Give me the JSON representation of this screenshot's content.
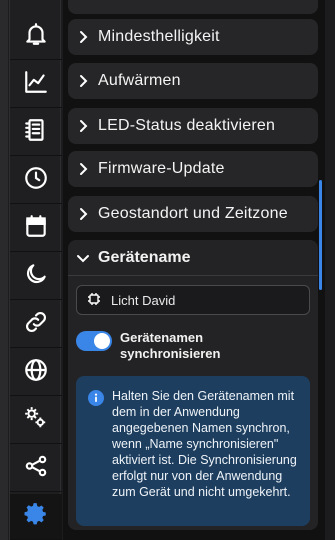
{
  "colors": {
    "accent": "#3a86e8",
    "info_bg": "#1d3e5f",
    "row_bg": "#262628"
  },
  "sidebar": {
    "items": [
      {
        "icon": "bell-icon"
      },
      {
        "icon": "line-chart-icon"
      },
      {
        "icon": "led-panel-icon"
      },
      {
        "icon": "clock-icon"
      },
      {
        "icon": "calendar-icon"
      },
      {
        "icon": "moon-icon"
      },
      {
        "icon": "link-icon"
      },
      {
        "icon": "globe-icon"
      },
      {
        "icon": "gears-icon"
      },
      {
        "icon": "share-icon"
      },
      {
        "icon": "settings-gear-icon",
        "active": true
      }
    ]
  },
  "sections": [
    {
      "label": "Mindesthelligkeit"
    },
    {
      "label": "Aufwärmen"
    },
    {
      "label": "LED-Status deaktivieren"
    },
    {
      "label": "Firmware-Update"
    },
    {
      "label": "Geostandort und Zeitzone"
    }
  ],
  "device_name": {
    "label": "Gerätename",
    "value": "Licht David",
    "toggle_label": "Gerätenamen synchronisieren",
    "toggle_on": true,
    "info": "Halten Sie den Gerätenamen mit dem in der Anwendung angegebenen Namen synchron, wenn „Name synchronisieren\" aktiviert ist. Die Synchronisierung erfolgt nur von der Anwendung zum Gerät und nicht umgekehrt."
  }
}
